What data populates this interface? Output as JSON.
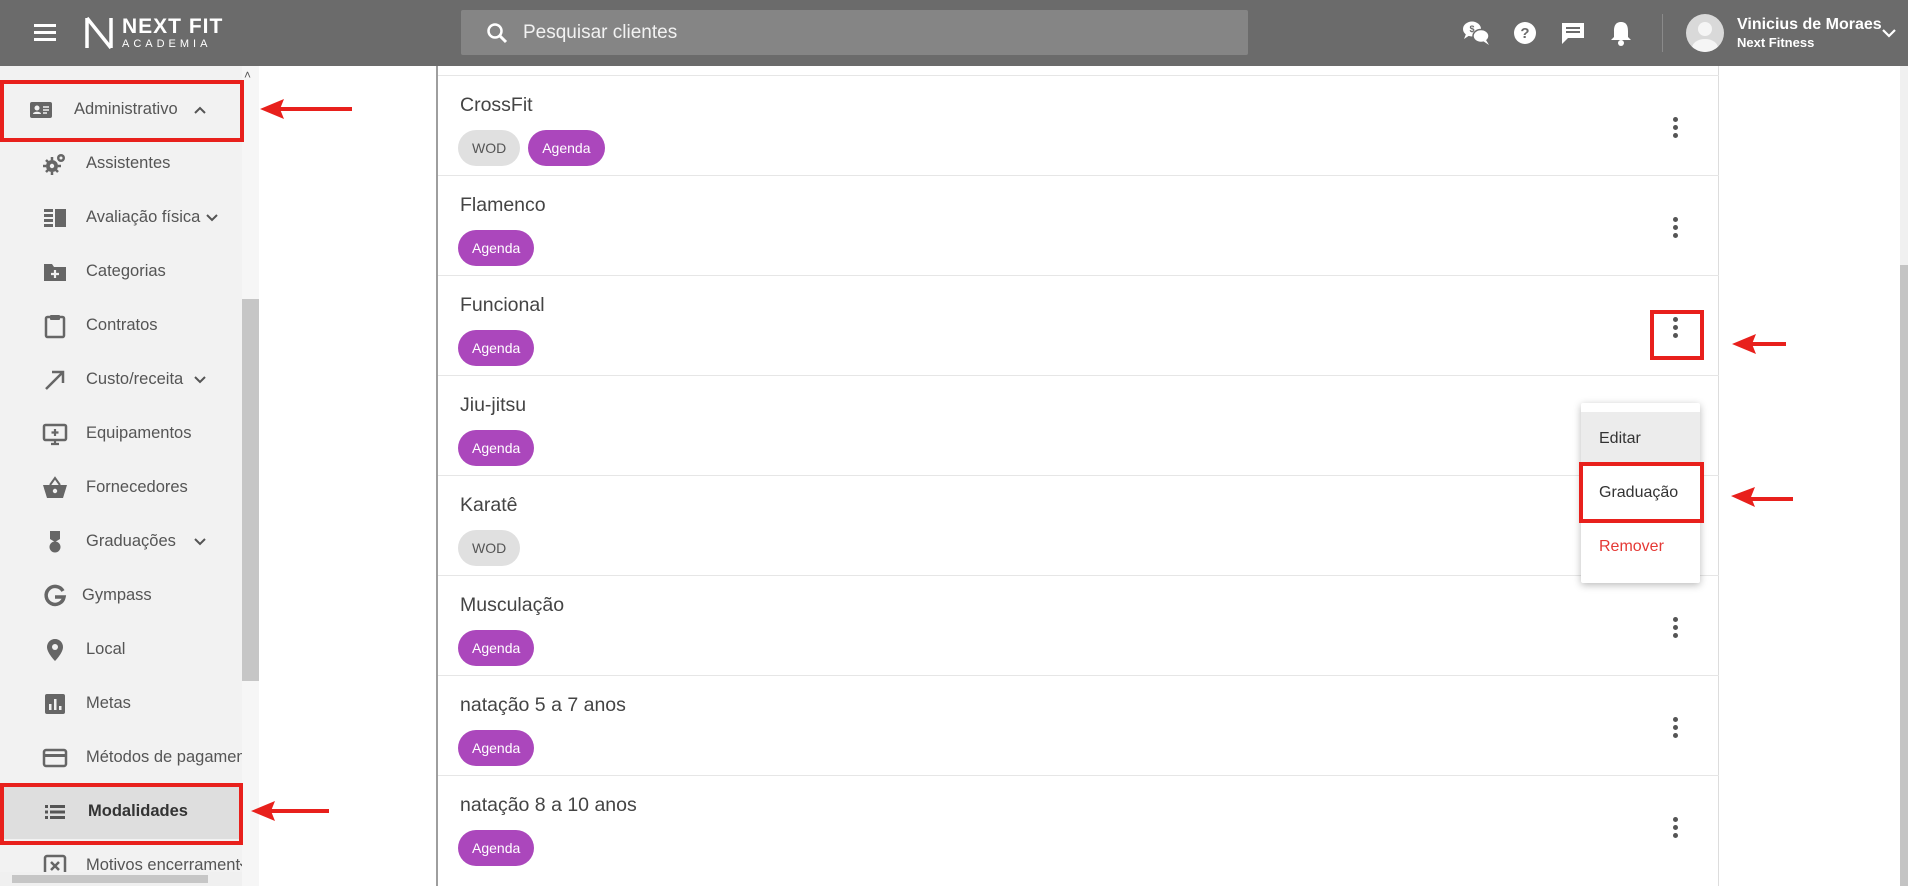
{
  "header": {
    "logo_main": "NEXT FIT",
    "logo_sub": "ACADEMIA",
    "search_placeholder": "Pesquisar clientes",
    "user_name": "Vinicius de Moraes",
    "user_company": "Next Fitness"
  },
  "sidebar": {
    "items": [
      {
        "label": "Administrativo",
        "icon": "id-card-icon",
        "expanded": true
      },
      {
        "label": "Assistentes",
        "icon": "gears-icon"
      },
      {
        "label": "Avaliação física",
        "icon": "assessment-icon",
        "has_children": true
      },
      {
        "label": "Categorias",
        "icon": "folder-add-icon"
      },
      {
        "label": "Contratos",
        "icon": "clipboard-icon"
      },
      {
        "label": "Custo/receita",
        "icon": "trend-arrow-icon",
        "has_children": true
      },
      {
        "label": "Equipamentos",
        "icon": "monitor-add-icon"
      },
      {
        "label": "Fornecedores",
        "icon": "basket-icon"
      },
      {
        "label": "Graduações",
        "icon": "medal-icon",
        "has_children": true
      },
      {
        "label": "Gympass",
        "icon": "google-g-icon"
      },
      {
        "label": "Local",
        "icon": "map-pin-icon"
      },
      {
        "label": "Metas",
        "icon": "bar-chart-icon"
      },
      {
        "label": "Métodos de pagamen",
        "icon": "credit-card-icon"
      },
      {
        "label": "Modalidades",
        "icon": "list-icon",
        "active": true
      },
      {
        "label": "Motivos encerrament",
        "icon": "close-box-icon"
      }
    ]
  },
  "modalities": [
    {
      "name": "CrossFit",
      "tags": [
        "WOD",
        "Agenda"
      ]
    },
    {
      "name": "Flamenco",
      "tags": [
        "Agenda"
      ]
    },
    {
      "name": "Funcional",
      "tags": [
        "Agenda"
      ]
    },
    {
      "name": "Jiu-jitsu",
      "tags": [
        "Agenda"
      ]
    },
    {
      "name": "Karatê",
      "tags": [
        "WOD"
      ]
    },
    {
      "name": "Musculação",
      "tags": [
        "Agenda"
      ]
    },
    {
      "name": "natação 5 a 7 anos",
      "tags": [
        "Agenda"
      ]
    },
    {
      "name": "natação 8 a 10 anos",
      "tags": [
        "Agenda"
      ]
    }
  ],
  "context_menu": {
    "edit": "Editar",
    "graduation": "Graduação",
    "remove": "Remover"
  },
  "colors": {
    "topbar": "#6b6b6b",
    "agenda_chip": "#ab47bc",
    "wod_chip": "#e0e0e0",
    "annotation": "#e8201c",
    "remove_text": "#e53935"
  }
}
